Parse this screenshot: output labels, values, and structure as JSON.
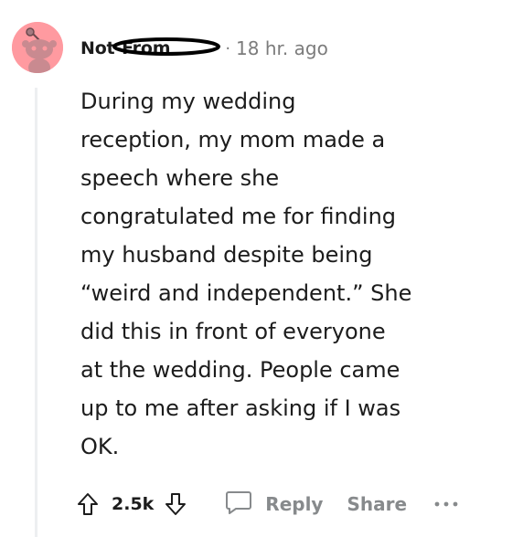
{
  "comment": {
    "username": "Not-From",
    "separator": "·",
    "timestamp": "18 hr. ago",
    "body_lines": [
      "During my wedding",
      "reception, my mom made a",
      "speech where she",
      "congratulated me for finding",
      "my husband despite being",
      "“weird and independent.” She",
      "did this in front of everyone",
      "at the wedding. People came",
      "up to me after asking if I was",
      "OK."
    ]
  },
  "actions": {
    "upvote_icon": "upvote-arrow-icon",
    "vote_count": "2.5k",
    "downvote_icon": "downvote-arrow-icon",
    "reply_icon": "chat-bubble-icon",
    "reply_label": "Reply",
    "share_label": "Share",
    "more_icon": "more-dots-icon"
  },
  "colors": {
    "avatar_bg": "#ff9aa0",
    "text": "#1c1c1c",
    "muted": "#7c7c7c",
    "action_gray": "#878a8c"
  }
}
